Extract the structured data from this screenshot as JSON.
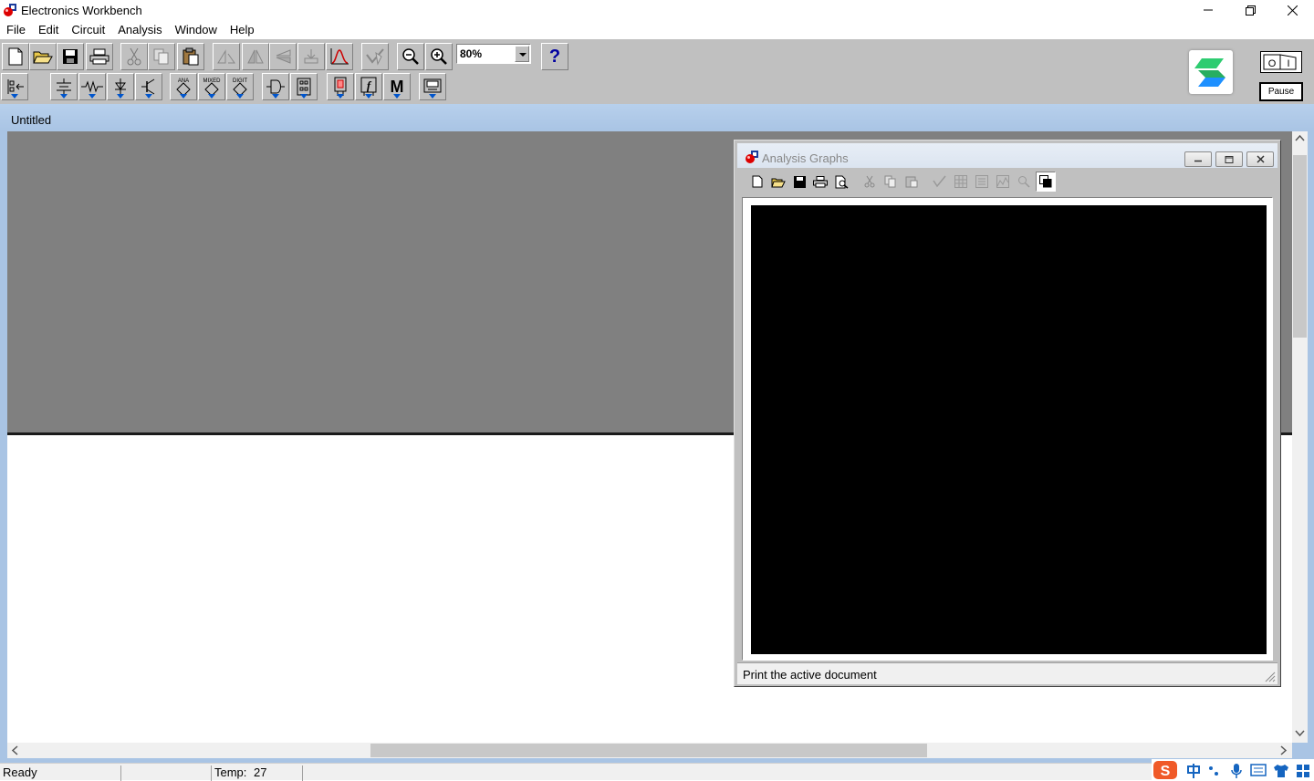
{
  "app": {
    "title": "Electronics Workbench"
  },
  "menu": [
    "File",
    "Edit",
    "Circuit",
    "Analysis",
    "Window",
    "Help"
  ],
  "toolbar": {
    "zoom_value": "80%",
    "help_label": "?",
    "parts_labels": {
      "analog": "ANA",
      "mixed": "MIXED",
      "digital": "DIGIT",
      "misc": "M"
    },
    "power": {
      "on_label": "O",
      "off_label": "I"
    },
    "pause_label": "Pause"
  },
  "document": {
    "title": "Untitled"
  },
  "analysis_graphs": {
    "title": "Analysis Graphs",
    "status_text": "Print the active document"
  },
  "status": {
    "ready": "Ready",
    "temp_label": "Temp:",
    "temp_value": "27"
  },
  "colors": {
    "accent_blue": "#0055cc",
    "canvas_gray": "#808080",
    "mdi_blue": "#a9c4e4",
    "logo_green": "#2ecc71",
    "logo_blue": "#1e90ff"
  }
}
